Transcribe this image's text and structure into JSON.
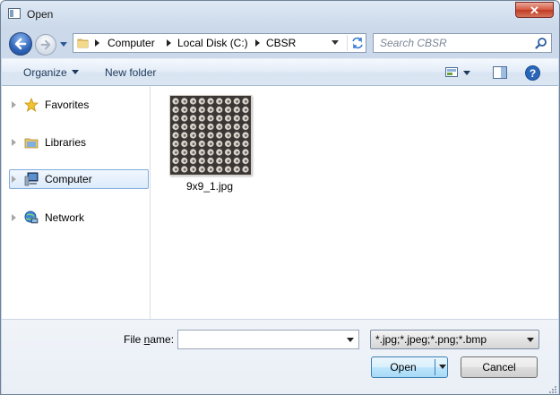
{
  "window": {
    "title": "Open",
    "close_label": "✕"
  },
  "nav_buttons": {
    "back": "back",
    "forward": "forward"
  },
  "address": {
    "crumbs": [
      "Computer",
      "Local Disk (C:)",
      "CBSR"
    ]
  },
  "search": {
    "placeholder": "Search CBSR"
  },
  "toolbar": {
    "organize_label": "Organize",
    "new_folder_label": "New folder"
  },
  "nav_pane": {
    "items": [
      {
        "label": "Favorites",
        "icon": "star-icon"
      },
      {
        "label": "Libraries",
        "icon": "library-icon"
      },
      {
        "label": "Computer",
        "icon": "computer-icon",
        "selected": true
      },
      {
        "label": "Network",
        "icon": "network-icon"
      }
    ]
  },
  "files": [
    {
      "name": "9x9_1.jpg",
      "thumbnail": "9x9 dot grid image"
    }
  ],
  "bottom": {
    "file_name_label_pre": "File ",
    "file_name_label_ul": "n",
    "file_name_label_post": "ame:",
    "file_name_value": "",
    "filter_value": "*.jpg;*.jpeg;*.png;*.bmp",
    "open_label": "Open",
    "cancel_label": "Cancel"
  }
}
